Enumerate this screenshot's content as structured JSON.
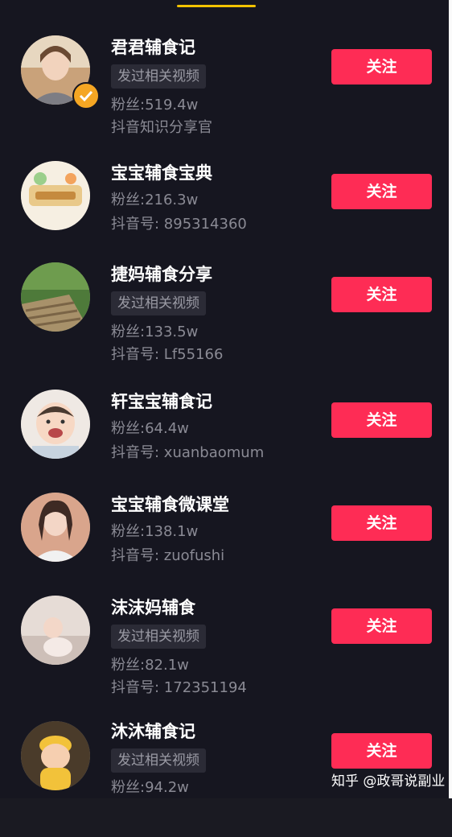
{
  "accounts": [
    {
      "name": "君君辅食记",
      "tag": "发过相关视频",
      "fans": "粉丝:519.4w",
      "id_line": "抖音知识分享官",
      "follow": "关注",
      "verified": true,
      "avatar": "woman-portrait"
    },
    {
      "name": "宝宝辅食宝典",
      "tag": "",
      "fans": "粉丝:216.3w",
      "id_line": "抖音号: 895314360",
      "follow": "关注",
      "verified": false,
      "avatar": "cartoon-logo"
    },
    {
      "name": "捷妈辅食分享",
      "tag": "发过相关视频",
      "fans": "粉丝:133.5w",
      "id_line": "抖音号: Lf55166",
      "follow": "关注",
      "verified": false,
      "avatar": "garden-stairs"
    },
    {
      "name": "轩宝宝辅食记",
      "tag": "",
      "fans": "粉丝:64.4w",
      "id_line": "抖音号: xuanbaomum",
      "follow": "关注",
      "verified": false,
      "avatar": "baby-face"
    },
    {
      "name": "宝宝辅食微课堂",
      "tag": "",
      "fans": "粉丝:138.1w",
      "id_line": "抖音号: zuofushi",
      "follow": "关注",
      "verified": false,
      "avatar": "woman-portrait-2"
    },
    {
      "name": "沫沫妈辅食",
      "tag": "发过相关视频",
      "fans": "粉丝:82.1w",
      "id_line": "抖音号: 172351194",
      "follow": "关注",
      "verified": false,
      "avatar": "baby-on-sofa"
    },
    {
      "name": "沐沐辅食记",
      "tag": "发过相关视频",
      "fans": "粉丝:94.2w",
      "id_line": "",
      "follow": "关注",
      "verified": false,
      "avatar": "cartoon-doll"
    }
  ],
  "watermark": "知乎 @政哥说副业",
  "colors": {
    "background": "#161620",
    "follow_button": "#fe2c55",
    "tab_indicator": "#f2c200",
    "verified_badge": "#f5a623"
  }
}
